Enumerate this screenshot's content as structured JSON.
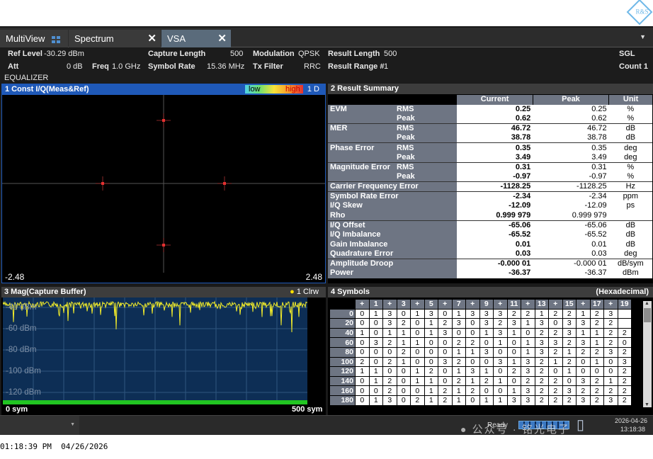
{
  "brand": {
    "logo_text": "R&S"
  },
  "tabs": {
    "multiview": "MultiView",
    "spectrum": "Spectrum",
    "vsa": "VSA"
  },
  "info": {
    "ref_level_label": "Ref Level",
    "ref_level_value": "-30.29 dBm",
    "att_label": "Att",
    "att_value": "0 dB",
    "freq_label": "Freq",
    "freq_value": "1.0 GHz",
    "capture_length_label": "Capture Length",
    "capture_length_value": "500",
    "symbol_rate_label": "Symbol Rate",
    "symbol_rate_value": "15.36 MHz",
    "modulation_label": "Modulation",
    "modulation_value": "QPSK",
    "tx_filter_label": "Tx Filter",
    "tx_filter_value": "RRC",
    "result_length_label": "Result Length",
    "result_length_value": "500",
    "result_range_label": "Result Range #",
    "result_range_value": "1",
    "sgl": "SGL",
    "count": "Count 1",
    "equalizer": "EQUALIZER"
  },
  "panel1": {
    "title": "1 Const I/Q(Meas&Ref)",
    "legend_low": "low",
    "legend_high": "high",
    "badge": "1 D",
    "x_min": "-2.48",
    "x_max": "2.48"
  },
  "panel2": {
    "title": "2 Result Summary",
    "headers": [
      "Current",
      "Peak",
      "Unit"
    ],
    "rows": [
      {
        "label": "EVM",
        "sub": "RMS",
        "current": "0.25",
        "peak": "0.25",
        "unit": "%"
      },
      {
        "label": "",
        "sub": "Peak",
        "current": "0.62",
        "peak": "0.62",
        "unit": "%"
      },
      {
        "label": "MER",
        "sub": "RMS",
        "current": "46.72",
        "peak": "46.72",
        "unit": "dB"
      },
      {
        "label": "",
        "sub": "Peak",
        "current": "38.78",
        "peak": "38.78",
        "unit": "dB"
      },
      {
        "label": "Phase Error",
        "sub": "RMS",
        "current": "0.35",
        "peak": "0.35",
        "unit": "deg"
      },
      {
        "label": "",
        "sub": "Peak",
        "current": "3.49",
        "peak": "3.49",
        "unit": "deg"
      },
      {
        "label": "Magnitude Error",
        "sub": "RMS",
        "current": "0.31",
        "peak": "0.31",
        "unit": "%"
      },
      {
        "label": "",
        "sub": "Peak",
        "current": "-0.97",
        "peak": "-0.97",
        "unit": "%"
      },
      {
        "label": "Carrier Frequency Error",
        "sub": "",
        "current": "-1128.25",
        "peak": "-1128.25",
        "unit": "Hz"
      },
      {
        "label": "Symbol Rate Error",
        "sub": "",
        "current": "-2.34",
        "peak": "-2.34",
        "unit": "ppm"
      },
      {
        "label": "I/Q Skew",
        "sub": "",
        "current": "-12.09",
        "peak": "-12.09",
        "unit": "ps"
      },
      {
        "label": "Rho",
        "sub": "",
        "current": "0.999 979",
        "peak": "0.999 979",
        "unit": ""
      },
      {
        "label": "I/Q Offset",
        "sub": "",
        "current": "-65.06",
        "peak": "-65.06",
        "unit": "dB"
      },
      {
        "label": "I/Q Imbalance",
        "sub": "",
        "current": "-65.52",
        "peak": "-65.52",
        "unit": "dB"
      },
      {
        "label": "Gain Imbalance",
        "sub": "",
        "current": "0.01",
        "peak": "0.01",
        "unit": "dB"
      },
      {
        "label": "Quadrature Error",
        "sub": "",
        "current": "0.03",
        "peak": "0.03",
        "unit": "deg"
      },
      {
        "label": "Amplitude Droop",
        "sub": "",
        "current": "-0.000 01",
        "peak": "-0.000 01",
        "unit": "dB/sym"
      },
      {
        "label": "Power",
        "sub": "",
        "current": "-36.37",
        "peak": "-36.37",
        "unit": "dBm"
      }
    ]
  },
  "panel3": {
    "title": "3 Mag(Capture Buffer)",
    "badge": "1 Clrw",
    "y_labels": [
      "-40 dBm",
      "-60 dBm",
      "-80 dBm",
      "-100 dBm",
      "-120 dBm"
    ],
    "x_min": "0 sym",
    "x_max": "500 sym"
  },
  "panel4": {
    "title": "4 Symbols",
    "format": "(Hexadecimal)",
    "col_headers": [
      "+",
      "1",
      "+",
      "3",
      "+",
      "5",
      "+",
      "7",
      "+",
      "9",
      "+",
      "11",
      "+",
      "13",
      "+",
      "15",
      "+",
      "17",
      "+",
      "19"
    ],
    "rows": [
      {
        "offset": "0",
        "cells": [
          "0",
          "1",
          "3",
          "0",
          "1",
          "3",
          "0",
          "1",
          "3",
          "3",
          "3",
          "2",
          "2",
          "1",
          "2",
          "2",
          "1",
          "2",
          "3"
        ]
      },
      {
        "offset": "20",
        "cells": [
          "0",
          "0",
          "3",
          "2",
          "0",
          "1",
          "2",
          "3",
          "0",
          "3",
          "2",
          "3",
          "1",
          "3",
          "0",
          "3",
          "3",
          "2",
          "2"
        ]
      },
      {
        "offset": "40",
        "cells": [
          "1",
          "0",
          "1",
          "1",
          "0",
          "1",
          "3",
          "0",
          "0",
          "1",
          "3",
          "1",
          "0",
          "2",
          "2",
          "3",
          "1",
          "1",
          "2",
          "2"
        ]
      },
      {
        "offset": "60",
        "cells": [
          "0",
          "3",
          "2",
          "1",
          "1",
          "0",
          "0",
          "2",
          "2",
          "0",
          "1",
          "0",
          "1",
          "3",
          "3",
          "2",
          "3",
          "1",
          "2",
          "0"
        ]
      },
      {
        "offset": "80",
        "cells": [
          "0",
          "0",
          "0",
          "2",
          "0",
          "0",
          "0",
          "1",
          "1",
          "3",
          "0",
          "0",
          "1",
          "3",
          "2",
          "1",
          "2",
          "2",
          "3",
          "2"
        ]
      },
      {
        "offset": "100",
        "cells": [
          "2",
          "0",
          "2",
          "1",
          "0",
          "0",
          "3",
          "2",
          "0",
          "0",
          "3",
          "1",
          "3",
          "2",
          "1",
          "2",
          "0",
          "1",
          "0",
          "3"
        ]
      },
      {
        "offset": "120",
        "cells": [
          "1",
          "1",
          "0",
          "0",
          "1",
          "2",
          "0",
          "1",
          "3",
          "1",
          "0",
          "2",
          "3",
          "2",
          "0",
          "1",
          "0",
          "0",
          "0",
          "2"
        ]
      },
      {
        "offset": "140",
        "cells": [
          "0",
          "1",
          "2",
          "0",
          "1",
          "1",
          "0",
          "2",
          "1",
          "2",
          "1",
          "0",
          "2",
          "2",
          "2",
          "0",
          "3",
          "2",
          "1",
          "2"
        ]
      },
      {
        "offset": "160",
        "cells": [
          "0",
          "0",
          "2",
          "0",
          "0",
          "1",
          "2",
          "1",
          "2",
          "0",
          "0",
          "1",
          "3",
          "2",
          "2",
          "3",
          "2",
          "2",
          "2",
          "2"
        ]
      },
      {
        "offset": "180",
        "cells": [
          "0",
          "1",
          "3",
          "0",
          "2",
          "1",
          "2",
          "1",
          "0",
          "1",
          "1",
          "3",
          "3",
          "2",
          "2",
          "2",
          "3",
          "2",
          "3",
          "2"
        ]
      }
    ]
  },
  "status": {
    "ready": "Ready",
    "date": "2026-04-26",
    "time": "13:18:38",
    "watermark": "公众号 · 铭光电子",
    "wave_hint": "~"
  },
  "footer": {
    "timestamp": "01:18:39 PM  04/26/2026"
  }
}
